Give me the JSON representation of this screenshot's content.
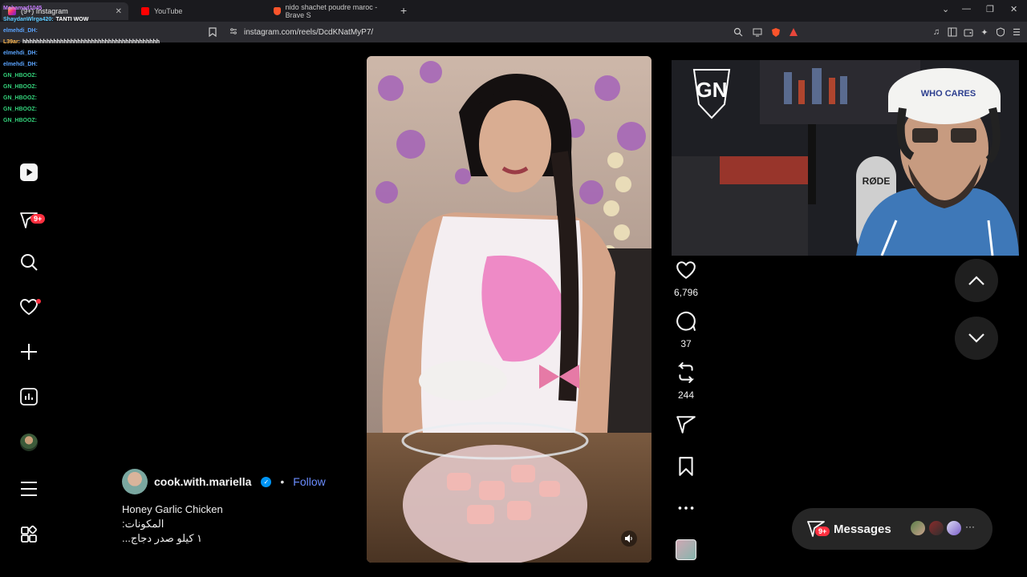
{
  "browser": {
    "tabs": [
      {
        "label": "(9+) Instagram",
        "active": true
      },
      {
        "label": "YouTube",
        "active": false
      },
      {
        "label": "nido shachet poudre maroc - Brave S",
        "active": false
      }
    ],
    "url": "instagram.com/reels/DcdKNatMyP7/",
    "window_controls": [
      "⌄",
      "—",
      "❐",
      "✕"
    ]
  },
  "chat": [
    {
      "user": "Mohamad1045",
      "text": "",
      "color": "#c87cff"
    },
    {
      "user": "ShaydanWlrga420:",
      "text": "TANTI WOW",
      "color": "#5ecbff"
    },
    {
      "user": "elmehdi_DH:",
      "text": "",
      "color": "#5aa4ff"
    },
    {
      "user": "L39ar:",
      "text": "hhhhhhhhhhhhhhhhhhhhhhhhhhhhhhhhhhhhhhhh",
      "color": "#ffb84d"
    },
    {
      "user": "elmehdi_DH:",
      "text": "",
      "color": "#5aa4ff"
    },
    {
      "user": "elmehdi_DH:",
      "text": "",
      "color": "#5aa4ff"
    },
    {
      "user": "GN_HBOOZ:",
      "text": "",
      "color": "#33d17a"
    },
    {
      "user": "GN_HBOOZ:",
      "text": "",
      "color": "#33d17a"
    },
    {
      "user": "GN_HBOOZ:",
      "text": "",
      "color": "#33d17a"
    },
    {
      "user": "GN_HBOOZ:",
      "text": "",
      "color": "#33d17a"
    },
    {
      "user": "GN_HBOOZ:",
      "text": "",
      "color": "#33d17a"
    }
  ],
  "sidenav": {
    "notifications_badge": "9+",
    "items": [
      "reels-icon",
      "messages-icon",
      "search-icon",
      "notifications-icon",
      "create-icon",
      "dashboard-icon",
      "profile-avatar",
      "menu-icon",
      "more-icon"
    ]
  },
  "reel": {
    "author": "cook.with.mariella",
    "separator": "•",
    "follow_label": "Follow",
    "caption_lines": [
      "Honey Garlic Chicken",
      "المكونات:",
      "١ كيلو صدر دجاج..."
    ]
  },
  "actions": {
    "likes": "6,796",
    "comments": "37",
    "reposts": "244"
  },
  "messages": {
    "label": "Messages",
    "badge": "9+",
    "more": "···"
  },
  "webcam": {
    "logo": "GN",
    "cap_text": "WHO CARES",
    "mic_brand": "RØDE"
  },
  "colors": {
    "accent": "#0095f6",
    "follow": "#6b8dff",
    "badge": "#ff3040"
  }
}
